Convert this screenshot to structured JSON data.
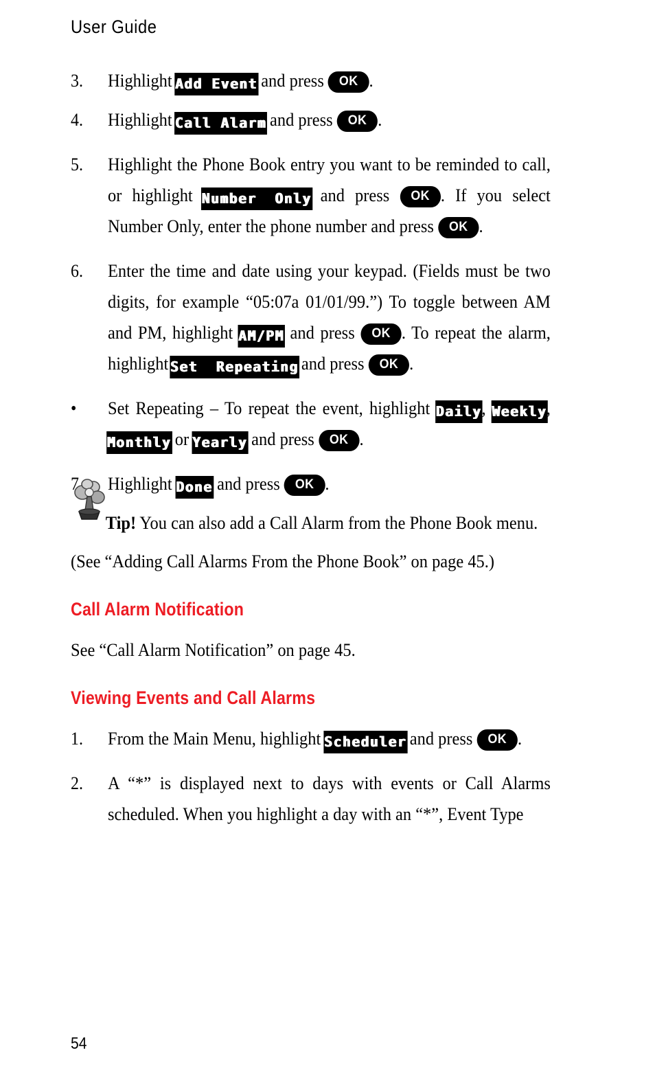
{
  "header": {
    "running_title": "User Guide"
  },
  "footer": {
    "page_number": "54"
  },
  "colors": {
    "heading_red": "#ED1C24",
    "text_black": "#000000",
    "page_background": "#FFFFFF",
    "lcd_background": "#000000",
    "lcd_text": "#FFFFFF"
  },
  "ok_key_label": "OK",
  "steps_add_call_alarm": [
    {
      "marker": "3.",
      "segments": [
        {
          "type": "text",
          "value": "Highlight "
        },
        {
          "type": "lcd",
          "value": "Add Event"
        },
        {
          "type": "text",
          "value": " and press "
        },
        {
          "type": "key",
          "value": "OK"
        },
        {
          "type": "text",
          "value": "."
        }
      ]
    },
    {
      "marker": "4.",
      "segments": [
        {
          "type": "text",
          "value": "Highlight "
        },
        {
          "type": "lcd",
          "value": "Call Alarm"
        },
        {
          "type": "text",
          "value": " and press "
        },
        {
          "type": "key",
          "value": "OK"
        },
        {
          "type": "text",
          "value": "."
        }
      ]
    },
    {
      "marker": "5.",
      "segments": [
        {
          "type": "text",
          "value": "Highlight the Phone Book entry you want to be reminded to call, or highlight "
        },
        {
          "type": "lcd",
          "value": "Number  Only"
        },
        {
          "type": "text",
          "value": " and press "
        },
        {
          "type": "key",
          "value": "OK"
        },
        {
          "type": "text",
          "value": ". If you select Number Only, enter the phone number and press "
        },
        {
          "type": "key",
          "value": "OK"
        },
        {
          "type": "text",
          "value": "."
        }
      ]
    },
    {
      "marker": "6.",
      "segments": [
        {
          "type": "text",
          "value": "Enter the time and date using your keypad. (Fields must be two digits, for example “05:07a  01/01/99.”) To toggle between AM and PM, highlight "
        },
        {
          "type": "lcd",
          "value": "AM/PM"
        },
        {
          "type": "text",
          "value": " and press "
        },
        {
          "type": "key",
          "value": "OK"
        },
        {
          "type": "text",
          "value": ". To repeat the alarm, highlight "
        },
        {
          "type": "lcd",
          "value": "Set  Repeating"
        },
        {
          "type": "text",
          "value": " and press "
        },
        {
          "type": "key",
          "value": "OK"
        },
        {
          "type": "text",
          "value": "."
        }
      ]
    },
    {
      "marker": "•",
      "segments": [
        {
          "type": "text",
          "value": "Set Repeating – To repeat the event, highlight "
        },
        {
          "type": "lcd",
          "value": "Daily"
        },
        {
          "type": "text",
          "value": ", "
        },
        {
          "type": "lcd",
          "value": "Weekly"
        },
        {
          "type": "text",
          "value": ", "
        },
        {
          "type": "lcd",
          "value": "Monthly"
        },
        {
          "type": "text",
          "value": " or "
        },
        {
          "type": "lcd",
          "value": "Yearly"
        },
        {
          "type": "text",
          "value": " and press "
        },
        {
          "type": "key",
          "value": "OK"
        },
        {
          "type": "text",
          "value": "."
        }
      ]
    },
    {
      "marker": "7.",
      "segments": [
        {
          "type": "text",
          "value": "Highlight "
        },
        {
          "type": "lcd",
          "value": "Done"
        },
        {
          "type": "text",
          "value": " and press "
        },
        {
          "type": "key",
          "value": "OK"
        },
        {
          "type": "text",
          "value": "."
        }
      ]
    }
  ],
  "tip": {
    "icon_name": "tip-clipart-icon",
    "lead": "Tip!",
    "body": " You can also add a Call Alarm from the Phone Book menu.",
    "cross_reference": "(See “Adding Call Alarms From the Phone Book” on page 45.)"
  },
  "section_call_alarm_notification": {
    "heading": "Call Alarm Notification",
    "body": "See “Call Alarm Notification” on page 45."
  },
  "section_viewing_events": {
    "heading": "Viewing Events and Call Alarms",
    "steps": [
      {
        "marker": "1.",
        "segments": [
          {
            "type": "text",
            "value": "From the Main Menu, highlight "
          },
          {
            "type": "lcd",
            "value": "Scheduler"
          },
          {
            "type": "text",
            "value": " and press "
          },
          {
            "type": "key",
            "value": "OK"
          },
          {
            "type": "text",
            "value": "."
          }
        ]
      },
      {
        "marker": "2.",
        "segments": [
          {
            "type": "text",
            "value": "A “*” is displayed next to days with events or Call Alarms scheduled. When you highlight a day with an “*”, Event Type"
          }
        ]
      }
    ]
  }
}
